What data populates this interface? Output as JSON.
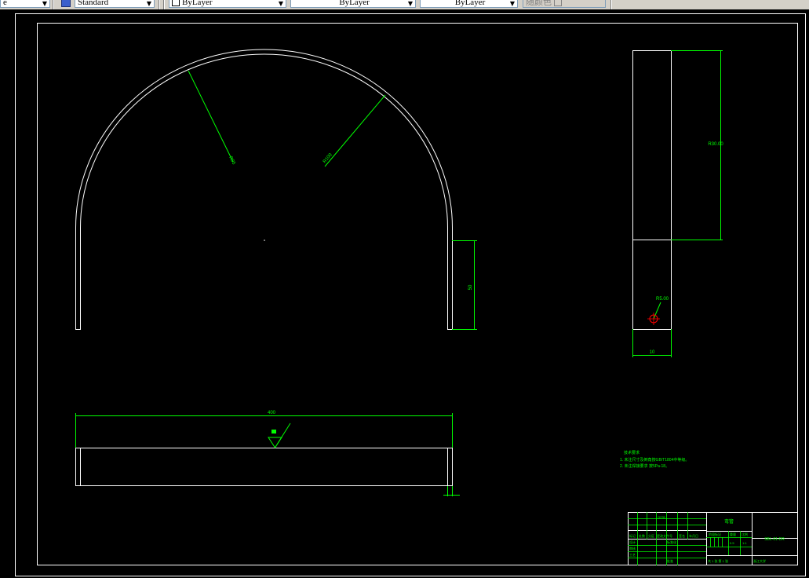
{
  "toolbar": {
    "left_partial": "e",
    "text_style": "Standard",
    "layer": "ByLayer",
    "linetype": "ByLayer",
    "lineweight": "ByLayer",
    "plotstyle": "随颜色"
  },
  "drawing": {
    "dims": {
      "r_inner": "R95",
      "r_outer": "R100",
      "leg_height": "50",
      "width": "400",
      "side_length": "R30.00",
      "hole_radius": "R5.00",
      "side_width": "10"
    },
    "notes": {
      "heading": "技术要求",
      "line1": "1. 未注尺寸及倒角按GB/T1804中等级。",
      "line2": "2. 未注焊接要求 按5Pa-18。"
    },
    "title_block": {
      "part_name": "弯管",
      "drawing_no": "SBL-01-DR",
      "material": "Q235",
      "scale": "1:1",
      "weight": "0.5",
      "company": "浙江大学",
      "labels": {
        "mark": "标记",
        "count": "处数",
        "zone": "分区",
        "change_doc": "更改文件号",
        "signature": "签名",
        "date": "年月日",
        "design": "设计",
        "standard": "标准化",
        "check": "审核",
        "craft": "工艺",
        "approve": "批准",
        "stage": "阶段标记",
        "weight_label": "重量",
        "scale_label": "比例",
        "sheets": "共 1 张 第 1 张"
      }
    }
  },
  "colors": {
    "background": "#000000",
    "geometry": "#ffffff",
    "dimension": "#00ff00",
    "marker": "#ff0000"
  }
}
